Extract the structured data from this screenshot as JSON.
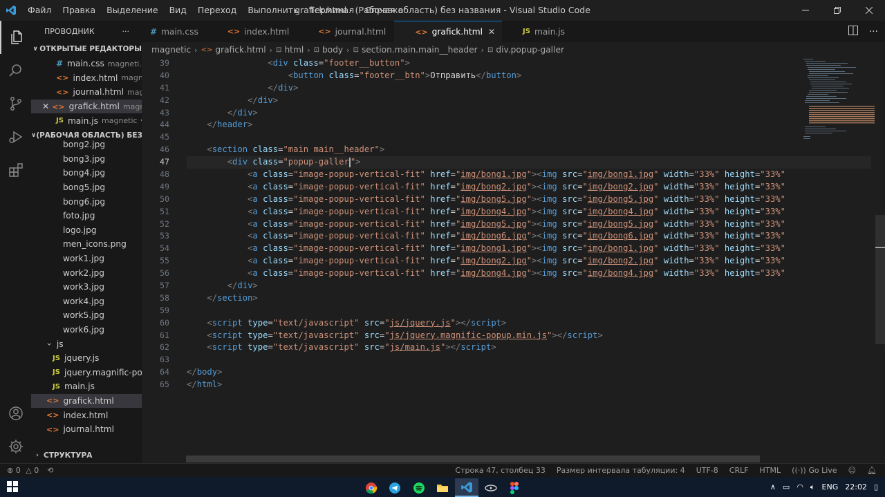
{
  "window": {
    "title": "grafick.html - (Рабочая область) без названия - Visual Studio Code",
    "menu": [
      "Файл",
      "Правка",
      "Выделение",
      "Вид",
      "Переход",
      "Выполнить",
      "Терминал",
      "Справка"
    ]
  },
  "sidebar": {
    "title": "ПРОВОДНИК",
    "open_editors_label": "ОТКРЫТЫЕ РЕДАКТОРЫ",
    "open_editors": [
      {
        "icon": "#",
        "type": "css",
        "name": "main.css",
        "path": "magneti..."
      },
      {
        "icon": "<>",
        "type": "html",
        "name": "index.html",
        "path": "magne..."
      },
      {
        "icon": "<>",
        "type": "html",
        "name": "journal.html",
        "path": "mag..."
      },
      {
        "icon": "<>",
        "type": "html",
        "name": "grafick.html",
        "path": "magn..."
      },
      {
        "icon": "JS",
        "type": "js",
        "name": "main.js",
        "path": "magnetic •..."
      }
    ],
    "workspace_label": "(РАБОЧАЯ ОБЛАСТЬ) БЕЗ ...",
    "files": [
      {
        "icon": "",
        "type": "img",
        "name": "bong2.jpg",
        "indent": 46
      },
      {
        "icon": "",
        "type": "img",
        "name": "bong3.jpg",
        "indent": 46
      },
      {
        "icon": "",
        "type": "img",
        "name": "bong4.jpg",
        "indent": 46
      },
      {
        "icon": "",
        "type": "img",
        "name": "bong5.jpg",
        "indent": 46
      },
      {
        "icon": "",
        "type": "img",
        "name": "bong6.jpg",
        "indent": 46
      },
      {
        "icon": "",
        "type": "img",
        "name": "foto.jpg",
        "indent": 46
      },
      {
        "icon": "",
        "type": "img",
        "name": "logo.jpg",
        "indent": 46
      },
      {
        "icon": "",
        "type": "img",
        "name": "men_icons.png",
        "indent": 46
      },
      {
        "icon": "",
        "type": "img",
        "name": "work1.jpg",
        "indent": 46
      },
      {
        "icon": "",
        "type": "img",
        "name": "work2.jpg",
        "indent": 46
      },
      {
        "icon": "",
        "type": "img",
        "name": "work3.jpg",
        "indent": 46
      },
      {
        "icon": "",
        "type": "img",
        "name": "work4.jpg",
        "indent": 46
      },
      {
        "icon": "",
        "type": "img",
        "name": "work5.jpg",
        "indent": 46
      },
      {
        "icon": "",
        "type": "img",
        "name": "work6.jpg",
        "indent": 46
      },
      {
        "icon": "›",
        "type": "folder",
        "name": "js",
        "indent": 24
      },
      {
        "icon": "JS",
        "type": "js",
        "name": "jquery.js",
        "indent": 31
      },
      {
        "icon": "JS",
        "type": "js",
        "name": "jquery.magnific-po...",
        "indent": 31
      },
      {
        "icon": "JS",
        "type": "js",
        "name": "main.js",
        "indent": 31
      },
      {
        "icon": "<>",
        "type": "html",
        "name": "grafick.html",
        "indent": 22
      },
      {
        "icon": "<>",
        "type": "html",
        "name": "index.html",
        "indent": 22
      },
      {
        "icon": "<>",
        "type": "html",
        "name": "journal.html",
        "indent": 22
      }
    ],
    "structure_label": "СТРУКТУРА"
  },
  "tabs": [
    {
      "icon": "#",
      "type": "css",
      "label": "main.css"
    },
    {
      "icon": "<>",
      "type": "html",
      "label": "index.html"
    },
    {
      "icon": "<>",
      "type": "html",
      "label": "journal.html"
    },
    {
      "icon": "<>",
      "type": "html",
      "label": "grafick.html"
    },
    {
      "icon": "JS",
      "type": "js",
      "label": "main.js"
    }
  ],
  "breadcrumb": [
    "magnetic",
    "grafick.html",
    "html",
    "body",
    "section.main.main__header",
    "div.popup-galler"
  ],
  "editor": {
    "line_numbers": [
      "39",
      "40",
      "41",
      "42",
      "43",
      "44",
      "45",
      "46",
      "47",
      "48",
      "49",
      "50",
      "51",
      "52",
      "53",
      "54",
      "55",
      "56",
      "57",
      "58",
      "59",
      "60",
      "61",
      "62",
      "63",
      "64",
      "65"
    ],
    "current_line": "47",
    "html_lines": [
      "                <span class=\"t\">&lt;</span><span class=\"tn\">div</span> <span class=\"an\">class</span>=<span class=\"av\">\"footer__button\"</span><span class=\"t\">&gt;</span>",
      "                    <span class=\"t\">&lt;</span><span class=\"tn\">button</span> <span class=\"an\">class</span>=<span class=\"av\">\"footer__btn\"</span><span class=\"t\">&gt;</span>Отправить<span class=\"t\">&lt;/</span><span class=\"tn\">button</span><span class=\"t\">&gt;</span>",
      "                <span class=\"t\">&lt;/</span><span class=\"tn\">div</span><span class=\"t\">&gt;</span>",
      "            <span class=\"t\">&lt;/</span><span class=\"tn\">div</span><span class=\"t\">&gt;</span>",
      "        <span class=\"t\">&lt;/</span><span class=\"tn\">div</span><span class=\"t\">&gt;</span>",
      "    <span class=\"t\">&lt;/</span><span class=\"tn\">header</span><span class=\"t\">&gt;</span>",
      "",
      "    <span class=\"t\">&lt;</span><span class=\"tn\">section</span> <span class=\"an\">class</span>=<span class=\"av\">\"main main__header\"</span><span class=\"t\">&gt;</span>",
      "        <span class=\"t\">&lt;</span><span class=\"tn\">div</span> <span class=\"an\">class</span>=<span class=\"av\">\"popup-galler</span><span class=\"caret\"></span><span class=\"av\">\"</span><span class=\"t\">&gt;</span>",
      "            <span class=\"t\">&lt;</span><span class=\"tn\">a</span> <span class=\"an\">class</span>=<span class=\"av\">\"image-popup-vertical-fit\"</span> <span class=\"an\">href</span>=<span class=\"av\">\"<span class=\"u\">img/bong1.jpg</span>\"</span><span class=\"t\">&gt;&lt;</span><span class=\"tn\">img</span> <span class=\"an\">src</span>=<span class=\"av\">\"<span class=\"u\">img/bong1.jpg</span>\"</span> <span class=\"an\">width</span>=<span class=\"av\">\"33%\"</span> <span class=\"an\">height</span>=<span class=\"av\">\"33%\"</span>",
      "            <span class=\"t\">&lt;</span><span class=\"tn\">a</span> <span class=\"an\">class</span>=<span class=\"av\">\"image-popup-vertical-fit\"</span> <span class=\"an\">href</span>=<span class=\"av\">\"<span class=\"u\">img/bong2.jpg</span>\"</span><span class=\"t\">&gt;&lt;</span><span class=\"tn\">img</span> <span class=\"an\">src</span>=<span class=\"av\">\"<span class=\"u\">img/bong2.jpg</span>\"</span> <span class=\"an\">width</span>=<span class=\"av\">\"33%\"</span> <span class=\"an\">height</span>=<span class=\"av\">\"33%\"</span>",
      "            <span class=\"t\">&lt;</span><span class=\"tn\">a</span> <span class=\"an\">class</span>=<span class=\"av\">\"image-popup-vertical-fit\"</span> <span class=\"an\">href</span>=<span class=\"av\">\"<span class=\"u\">img/bong5.jpg</span>\"</span><span class=\"t\">&gt;&lt;</span><span class=\"tn\">img</span> <span class=\"an\">src</span>=<span class=\"av\">\"<span class=\"u\">img/bong5.jpg</span>\"</span> <span class=\"an\">width</span>=<span class=\"av\">\"33%\"</span> <span class=\"an\">height</span>=<span class=\"av\">\"33%\"</span>",
      "            <span class=\"t\">&lt;</span><span class=\"tn\">a</span> <span class=\"an\">class</span>=<span class=\"av\">\"image-popup-vertical-fit\"</span> <span class=\"an\">href</span>=<span class=\"av\">\"<span class=\"u\">img/bong4.jpg</span>\"</span><span class=\"t\">&gt;&lt;</span><span class=\"tn\">img</span> <span class=\"an\">src</span>=<span class=\"av\">\"<span class=\"u\">img/bong4.jpg</span>\"</span> <span class=\"an\">width</span>=<span class=\"av\">\"33%\"</span> <span class=\"an\">height</span>=<span class=\"av\">\"33%\"</span>",
      "            <span class=\"t\">&lt;</span><span class=\"tn\">a</span> <span class=\"an\">class</span>=<span class=\"av\">\"image-popup-vertical-fit\"</span> <span class=\"an\">href</span>=<span class=\"av\">\"<span class=\"u\">img/bong5.jpg</span>\"</span><span class=\"t\">&gt;&lt;</span><span class=\"tn\">img</span> <span class=\"an\">src</span>=<span class=\"av\">\"<span class=\"u\">img/bong5.jpg</span>\"</span> <span class=\"an\">width</span>=<span class=\"av\">\"33%\"</span> <span class=\"an\">height</span>=<span class=\"av\">\"33%\"</span>",
      "            <span class=\"t\">&lt;</span><span class=\"tn\">a</span> <span class=\"an\">class</span>=<span class=\"av\">\"image-popup-vertical-fit\"</span> <span class=\"an\">href</span>=<span class=\"av\">\"<span class=\"u\">img/bong6.jpg</span>\"</span><span class=\"t\">&gt;&lt;</span><span class=\"tn\">img</span> <span class=\"an\">src</span>=<span class=\"av\">\"<span class=\"u\">img/bong6.jpg</span>\"</span> <span class=\"an\">width</span>=<span class=\"av\">\"33%\"</span> <span class=\"an\">height</span>=<span class=\"av\">\"33%\"</span>",
      "            <span class=\"t\">&lt;</span><span class=\"tn\">a</span> <span class=\"an\">class</span>=<span class=\"av\">\"image-popup-vertical-fit\"</span> <span class=\"an\">href</span>=<span class=\"av\">\"<span class=\"u\">img/bong1.jpg</span>\"</span><span class=\"t\">&gt;&lt;</span><span class=\"tn\">img</span> <span class=\"an\">src</span>=<span class=\"av\">\"<span class=\"u\">img/bong1.jpg</span>\"</span> <span class=\"an\">width</span>=<span class=\"av\">\"33%\"</span> <span class=\"an\">height</span>=<span class=\"av\">\"33%\"</span>",
      "            <span class=\"t\">&lt;</span><span class=\"tn\">a</span> <span class=\"an\">class</span>=<span class=\"av\">\"image-popup-vertical-fit\"</span> <span class=\"an\">href</span>=<span class=\"av\">\"<span class=\"u\">img/bong2.jpg</span>\"</span><span class=\"t\">&gt;&lt;</span><span class=\"tn\">img</span> <span class=\"an\">src</span>=<span class=\"av\">\"<span class=\"u\">img/bong2.jpg</span>\"</span> <span class=\"an\">width</span>=<span class=\"av\">\"33%\"</span> <span class=\"an\">height</span>=<span class=\"av\">\"33%\"</span>",
      "            <span class=\"t\">&lt;</span><span class=\"tn\">a</span> <span class=\"an\">class</span>=<span class=\"av\">\"image-popup-vertical-fit\"</span> <span class=\"an\">href</span>=<span class=\"av\">\"<span class=\"u\">img/bong4.jpg</span>\"</span><span class=\"t\">&gt;&lt;</span><span class=\"tn\">img</span> <span class=\"an\">src</span>=<span class=\"av\">\"<span class=\"u\">img/bong4.jpg</span>\"</span> <span class=\"an\">width</span>=<span class=\"av\">\"33%\"</span> <span class=\"an\">height</span>=<span class=\"av\">\"33%\"</span>",
      "        <span class=\"t\">&lt;/</span><span class=\"tn\">div</span><span class=\"t\">&gt;</span>",
      "    <span class=\"t\">&lt;/</span><span class=\"tn\">section</span><span class=\"t\">&gt;</span>",
      "",
      "    <span class=\"t\">&lt;</span><span class=\"tn\">script</span> <span class=\"an\">type</span>=<span class=\"av\">\"text/javascript\"</span> <span class=\"an\">src</span>=<span class=\"av\">\"<span class=\"u\">js/jquery.js</span>\"</span><span class=\"t\">&gt;&lt;/</span><span class=\"tn\">script</span><span class=\"t\">&gt;</span>",
      "    <span class=\"t\">&lt;</span><span class=\"tn\">script</span> <span class=\"an\">type</span>=<span class=\"av\">\"text/javascript\"</span> <span class=\"an\">src</span>=<span class=\"av\">\"<span class=\"u\">js/jquery.magnific-popup.min.js</span>\"</span><span class=\"t\">&gt;&lt;/</span><span class=\"tn\">script</span><span class=\"t\">&gt;</span>",
      "    <span class=\"t\">&lt;</span><span class=\"tn\">script</span> <span class=\"an\">type</span>=<span class=\"av\">\"text/javascript\"</span> <span class=\"an\">src</span>=<span class=\"av\">\"<span class=\"u\">js/main.js</span>\"</span><span class=\"t\">&gt;&lt;/</span><span class=\"tn\">script</span><span class=\"t\">&gt;</span>",
      "",
      "<span class=\"t\">&lt;/</span><span class=\"tn\">body</span><span class=\"t\">&gt;</span>",
      "<span class=\"t\">&lt;/</span><span class=\"tn\">html</span><span class=\"t\">&gt;</span>"
    ]
  },
  "status": {
    "errors": "0",
    "warnings": "0",
    "position": "Строка 47, столбец 33",
    "tab_size": "Размер интервала табуляции: 4",
    "encoding": "UTF-8",
    "eol": "CRLF",
    "language": "HTML",
    "go_live": "Go Live"
  },
  "taskbar": {
    "lang": "ENG",
    "time": "22:02"
  },
  "colors": {
    "accent": "#0078d4",
    "html_icon": "#e37933",
    "css_icon": "#519aba",
    "js_icon": "#cbcb41",
    "tag": "#569cd6",
    "attr_name": "#9cdcfe",
    "attr_value": "#ce9178"
  }
}
